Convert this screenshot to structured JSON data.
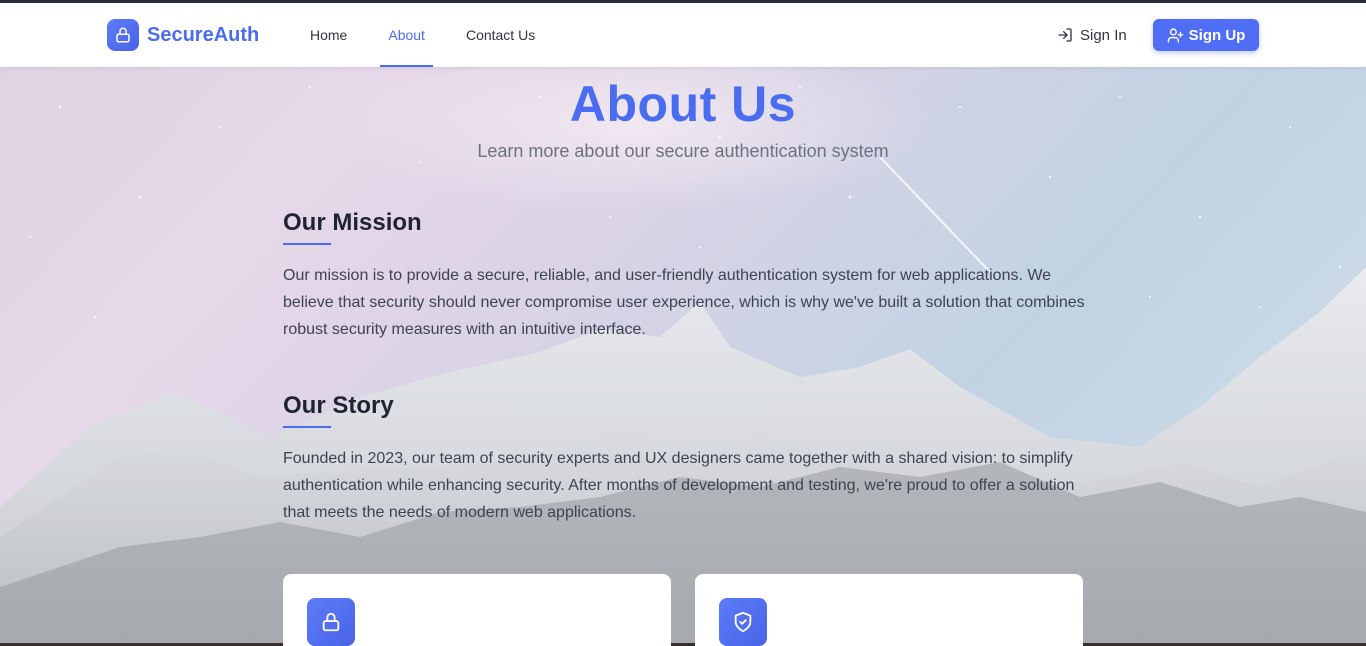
{
  "brand": {
    "name": "SecureAuth",
    "logo_icon": "lock-icon"
  },
  "nav": {
    "items": [
      {
        "label": "Home",
        "active": false
      },
      {
        "label": "About",
        "active": true
      },
      {
        "label": "Contact Us",
        "active": false
      }
    ]
  },
  "auth": {
    "sign_in_label": "Sign In",
    "sign_in_icon": "sign-in-icon",
    "sign_up_label": "Sign Up",
    "sign_up_icon": "user-plus-icon"
  },
  "hero": {
    "title": "About Us",
    "subtitle": "Learn more about our secure authentication system"
  },
  "sections": [
    {
      "title": "Our Mission",
      "body": "Our mission is to provide a secure, reliable, and user-friendly authentication system for web applications. We believe that security should never compromise user experience, which is why we've built a solution that combines robust security measures with an intuitive interface."
    },
    {
      "title": "Our Story",
      "body": "Founded in 2023, our team of security experts and UX designers came together with a shared vision: to simplify authentication while enhancing security. After months of development and testing, we're proud to offer a solution that meets the needs of modern web applications."
    }
  ],
  "cards": [
    {
      "icon": "lock-icon"
    },
    {
      "icon": "shield-check-icon"
    }
  ],
  "colors": {
    "accent": "#4a6cf0",
    "button": "#4f6ef5",
    "text_dark": "#1f2433",
    "text_body": "#3d4350"
  }
}
